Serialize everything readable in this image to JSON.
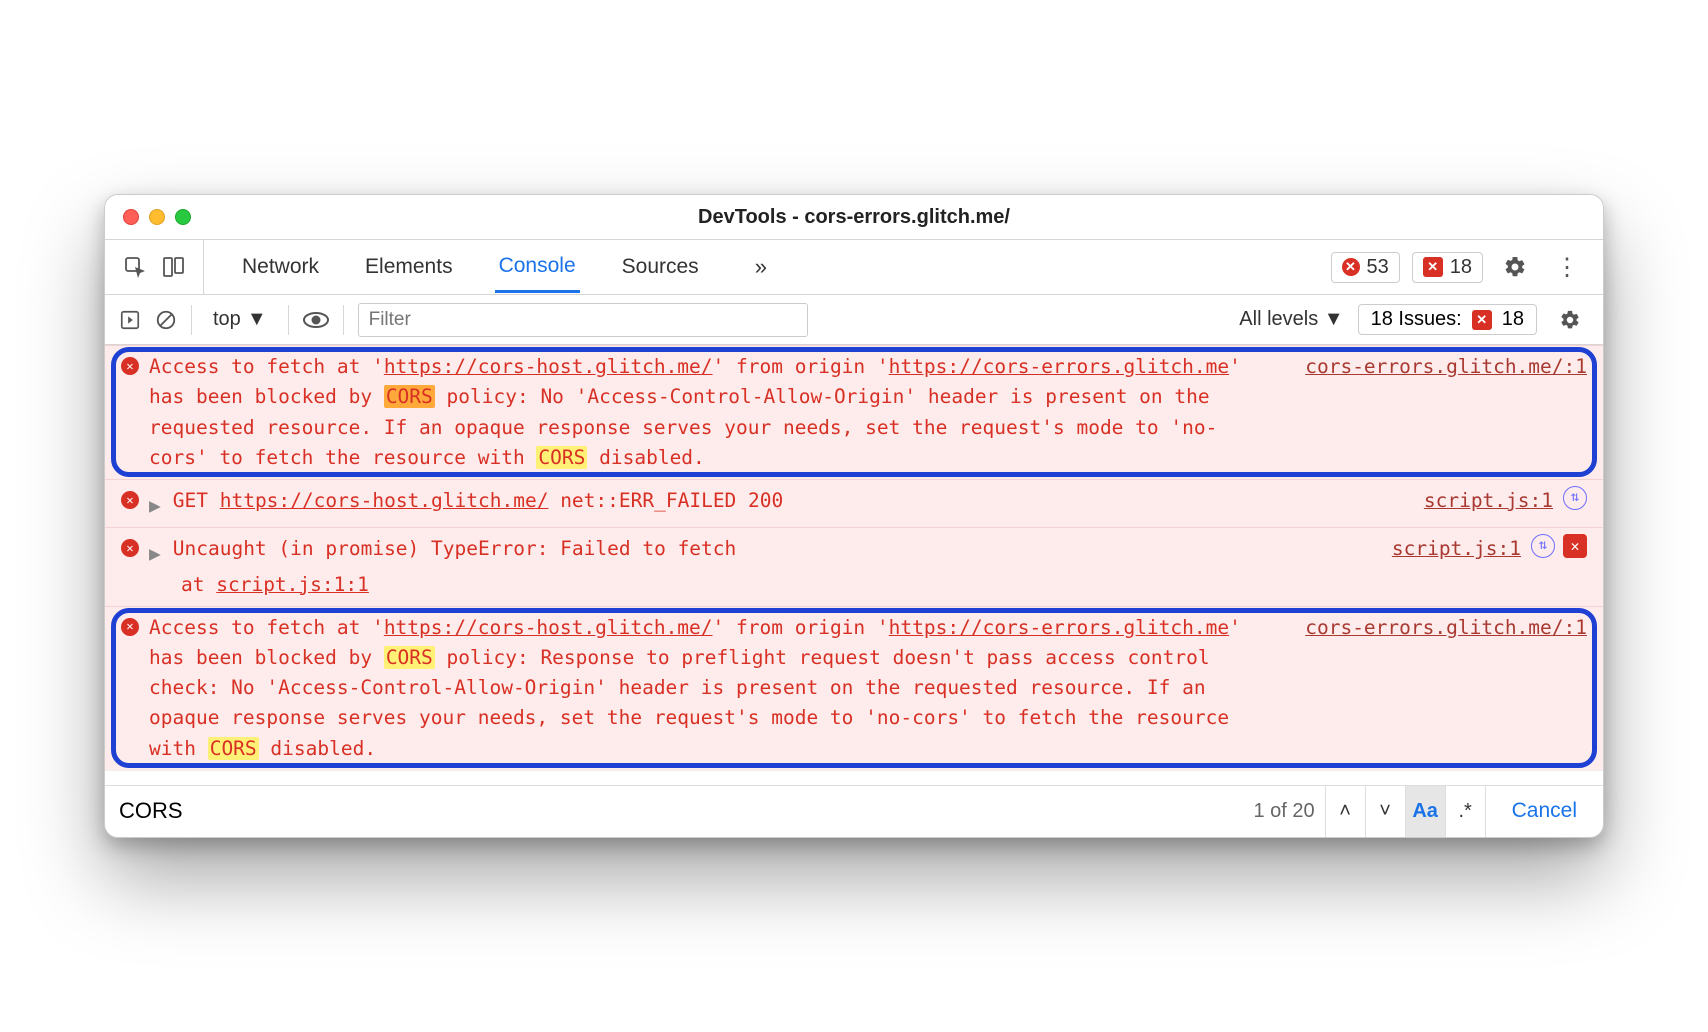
{
  "window": {
    "title": "DevTools - cors-errors.glitch.me/"
  },
  "tabs": {
    "network": "Network",
    "elements": "Elements",
    "console": "Console",
    "sources": "Sources"
  },
  "metrics": {
    "errors": "53",
    "issues": "18"
  },
  "console_toolbar": {
    "context": "top",
    "filter_placeholder": "Filter",
    "levels": "All levels",
    "issues_label": "18 Issues:",
    "issues_count": "18"
  },
  "messages": {
    "m1": {
      "p1": "Access to fetch at '",
      "url1": "https://cors-host.glitch.me/",
      "p2": "' from origin '",
      "url2": "https://cors-errors.glitch.me",
      "p3": "' has been blocked by ",
      "hl1": "CORS",
      "p4": " policy: No 'Access-Control-Allow-Origin' header is present on the requested resource. If an opaque response serves your needs, set the request's mode to 'no-cors' to fetch the resource with ",
      "hl2": "CORS",
      "p5": " disabled.",
      "source": "cors-errors.glitch.me/:1"
    },
    "m2": {
      "p1": "GET ",
      "url": "https://cors-host.glitch.me/",
      "p2": " net::ERR_FAILED 200",
      "source": "script.js:1"
    },
    "m3": {
      "p1": "Uncaught (in promise) TypeError: Failed to fetch",
      "stack_at": "    at ",
      "stack_loc": "script.js:1:1",
      "source": "script.js:1"
    },
    "m4": {
      "p1": "Access to fetch at '",
      "url1": "https://cors-host.glitch.me/",
      "p2": "' from origin '",
      "url2": "https://cors-errors.glitch.me",
      "p3": "' has been blocked by ",
      "hl1": "CORS",
      "p4": " policy: Response to preflight request doesn't pass access control check: No 'Access-Control-Allow-Origin' header is present on the requested resource. If an opaque response serves your needs, set the request's mode to 'no-cors' to fetch the resource with ",
      "hl2": "CORS",
      "p5": " disabled.",
      "source": "cors-errors.glitch.me/:1"
    }
  },
  "search": {
    "value": "CORS",
    "count": "1 of 20",
    "cancel": "Cancel",
    "aa": "Aa",
    "re": ".*"
  }
}
